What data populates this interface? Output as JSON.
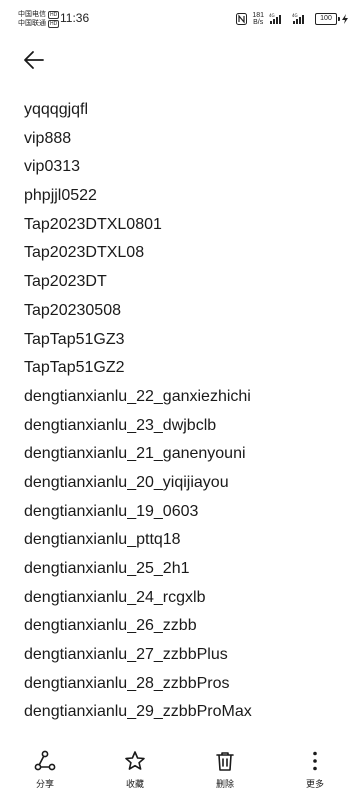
{
  "status_bar": {
    "carrier1": "中国电信",
    "carrier2": "中国联通",
    "carrier1_badge": "HD",
    "carrier2_badge": "HD",
    "time": "11:36",
    "net_speed_value": "181",
    "net_speed_unit": "B/s",
    "battery": "100"
  },
  "list": {
    "items": [
      "yqqqgjqfl",
      "vip888",
      "vip0313",
      "phpjjl0522",
      "Tap2023DTXL0801",
      "Tap2023DTXL08",
      "Tap2023DT",
      "Tap20230508",
      "TapTap51GZ3",
      "TapTap51GZ2",
      "dengtianxianlu_22_ganxiezhichi",
      "dengtianxianlu_23_dwjbclb",
      "dengtianxianlu_21_ganenyouni",
      "dengtianxianlu_20_yiqijiayou",
      "dengtianxianlu_19_0603",
      "dengtianxianlu_pttq18",
      "dengtianxianlu_25_2h1",
      "dengtianxianlu_24_rcgxlb",
      "dengtianxianlu_26_zzbb",
      "dengtianxianlu_27_zzbbPlus",
      "dengtianxianlu_28_zzbbPros",
      "dengtianxianlu_29_zzbbProMax"
    ]
  },
  "toolbar": {
    "share": "分享",
    "favorite": "收藏",
    "delete": "删除",
    "more": "更多"
  }
}
